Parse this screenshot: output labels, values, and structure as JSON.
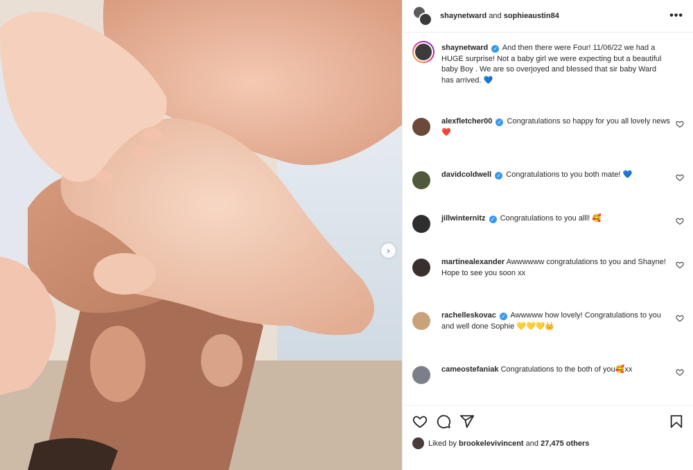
{
  "header": {
    "user1": "shaynetward",
    "and_text": "and",
    "user2": "sophieaustin84",
    "more_icon": "more-horizontal-icon"
  },
  "caption": {
    "username": "shaynetward",
    "text": "And then there were Four! 11/06/22 we had a HUGE surprise! Not a baby girl we were expecting but a beautiful baby Boy . We are so overjoyed and blessed that sir baby Ward has arrived.",
    "emoji": "💙"
  },
  "comments": [
    {
      "username": "alexfletcher00",
      "verified": true,
      "text": "Congratulations so happy for you all lovely news",
      "emoji": "❤️",
      "avatar_color": "#6b4a3a"
    },
    {
      "username": "davidcoldwell",
      "verified": true,
      "text": "Congratulations to you both mate!",
      "emoji": "💙",
      "avatar_color": "#4f5a3a"
    },
    {
      "username": "jillwinternitz",
      "verified": true,
      "text": "Congratulations to you alll!",
      "emoji": "🥰",
      "avatar_color": "#2e2e2e"
    },
    {
      "username": "martinealexander",
      "verified": false,
      "text": "Awwwwww congratulations to you and Shayne! Hope to see you soon xx",
      "emoji": "",
      "avatar_color": "#3a2f2f"
    },
    {
      "username": "rachelleskovac",
      "verified": true,
      "text": "Awwwww how lovely! Congratulations to you and well done Sophie",
      "emoji": "💛💛💛👑",
      "avatar_color": "#c9a27a"
    },
    {
      "username": "cameostefaniak",
      "verified": false,
      "text": "Congratulations to the both of you",
      "emoji": "🥰xx",
      "avatar_color": "#7a7f8a"
    }
  ],
  "actions": {
    "like_icon": "heart-icon",
    "comment_icon": "comment-icon",
    "share_icon": "share-icon",
    "save_icon": "bookmark-icon"
  },
  "likes": {
    "prefix": "Liked by",
    "user": "brookelevivincent",
    "and_text": "and",
    "count": "27,475 others"
  },
  "colors": {
    "verified": "#3897f0",
    "text": "#262626",
    "border": "#efefef"
  }
}
